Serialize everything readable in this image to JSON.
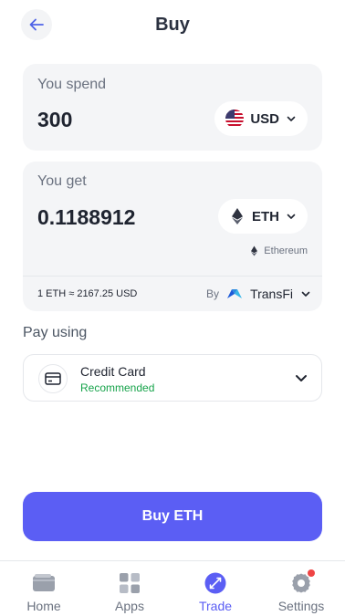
{
  "header": {
    "title": "Buy",
    "back_icon": "arrow-left-icon"
  },
  "spend": {
    "label": "You spend",
    "amount": "300",
    "currency": "USD",
    "currency_icon": "us-flag-icon"
  },
  "get": {
    "label": "You get",
    "amount": "0.1188912",
    "currency": "ETH",
    "currency_icon": "ethereum-icon",
    "network": "Ethereum",
    "rate": "1 ETH ≈ 2167.25 USD",
    "provider_prefix": "By",
    "provider_name": "TransFi"
  },
  "payment": {
    "label": "Pay using",
    "method_name": "Credit Card",
    "method_sub": "Recommended",
    "method_icon": "credit-card-icon"
  },
  "action": {
    "label": "Buy ETH"
  },
  "tabs": [
    {
      "label": "Home",
      "icon": "wallet-icon",
      "active": false
    },
    {
      "label": "Apps",
      "icon": "grid-icon",
      "active": false
    },
    {
      "label": "Trade",
      "icon": "swap-icon",
      "active": true
    },
    {
      "label": "Settings",
      "icon": "gear-icon",
      "active": false
    }
  ],
  "colors": {
    "accent": "#5b5ef4",
    "card_bg": "#f4f5f7",
    "recommended": "#16a34a",
    "badge": "#ef4444"
  }
}
